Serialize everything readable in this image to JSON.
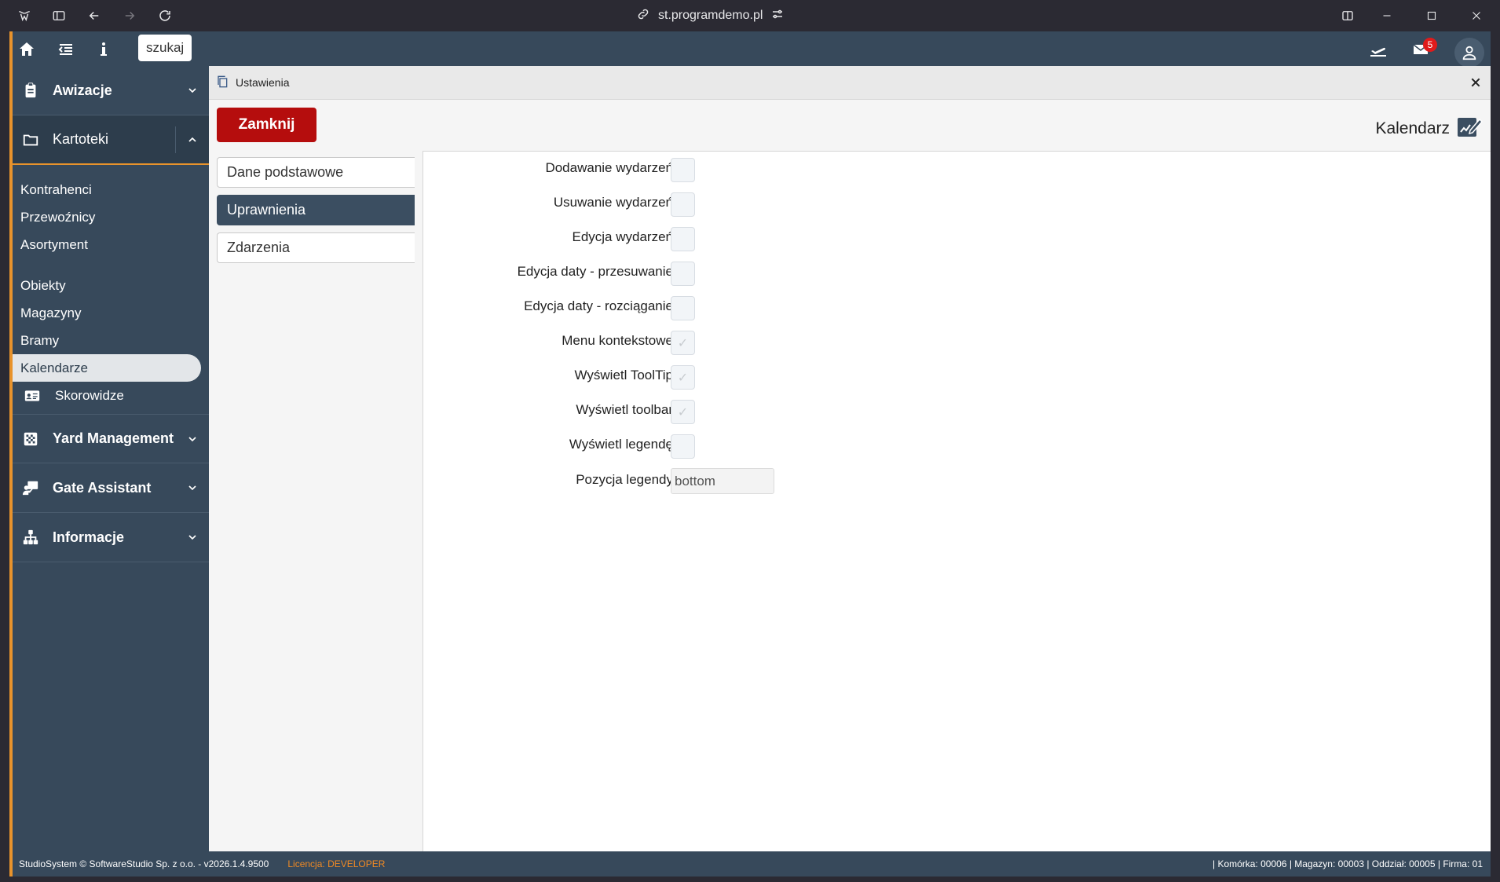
{
  "browser": {
    "url": "st.programdemo.pl"
  },
  "topbar": {
    "search_label": "szukaj",
    "mail_count": "5"
  },
  "sidebar": {
    "sections": {
      "awizacje": "Awizacje",
      "kartoteki": "Kartoteki",
      "yard": "Yard Management",
      "gate": "Gate Assistant",
      "info": "Informacje"
    },
    "items": {
      "kontrahenci": "Kontrahenci",
      "przewoznicy": "Przewoźnicy",
      "asortyment": "Asortyment",
      "obiekty": "Obiekty",
      "magazyny": "Magazyny",
      "bramy": "Bramy",
      "kalendarze": "Kalendarze",
      "skorowidze": "Skorowidze"
    }
  },
  "panel": {
    "title": "Ustawienia",
    "close_button": "Zamknij",
    "entity_title": "Kalendarz"
  },
  "tabs": {
    "dane": "Dane podstawowe",
    "uprawnienia": "Uprawnienia",
    "zdarzenia": "Zdarzenia"
  },
  "permissions": {
    "dodawanie": {
      "label": "Dodawanie wydarzeń",
      "checked": false
    },
    "usuwanie": {
      "label": "Usuwanie wydarzeń",
      "checked": false
    },
    "edycja": {
      "label": "Edycja wydarzeń",
      "checked": false
    },
    "przesuwanie": {
      "label": "Edycja daty - przesuwanie",
      "checked": false
    },
    "rozciaganie": {
      "label": "Edycja daty - rozciąganie",
      "checked": false
    },
    "menu": {
      "label": "Menu kontekstowe",
      "checked": true
    },
    "tooltip": {
      "label": "Wyświetl ToolTip",
      "checked": true
    },
    "toolbar": {
      "label": "Wyświetl toolbar",
      "checked": true
    },
    "legenda": {
      "label": "Wyświetl legendę",
      "checked": false
    },
    "pozycja": {
      "label": "Pozycja legendy",
      "value": "bottom"
    }
  },
  "footer": {
    "copyright": "StudioSystem © SoftwareStudio Sp. z o.o. - v2026.1.4.9500",
    "license_label": "Licencja:",
    "license_value": "DEVELOPER",
    "context": "| Komórka: 00006 | Magazyn: 00003 | Oddział: 00005 | Firma: 01"
  },
  "colors": {
    "sidebar_bg": "#37495b",
    "accent": "#e8932c",
    "close_button": "#b50d0d",
    "active_tab": "#3b4e61"
  }
}
